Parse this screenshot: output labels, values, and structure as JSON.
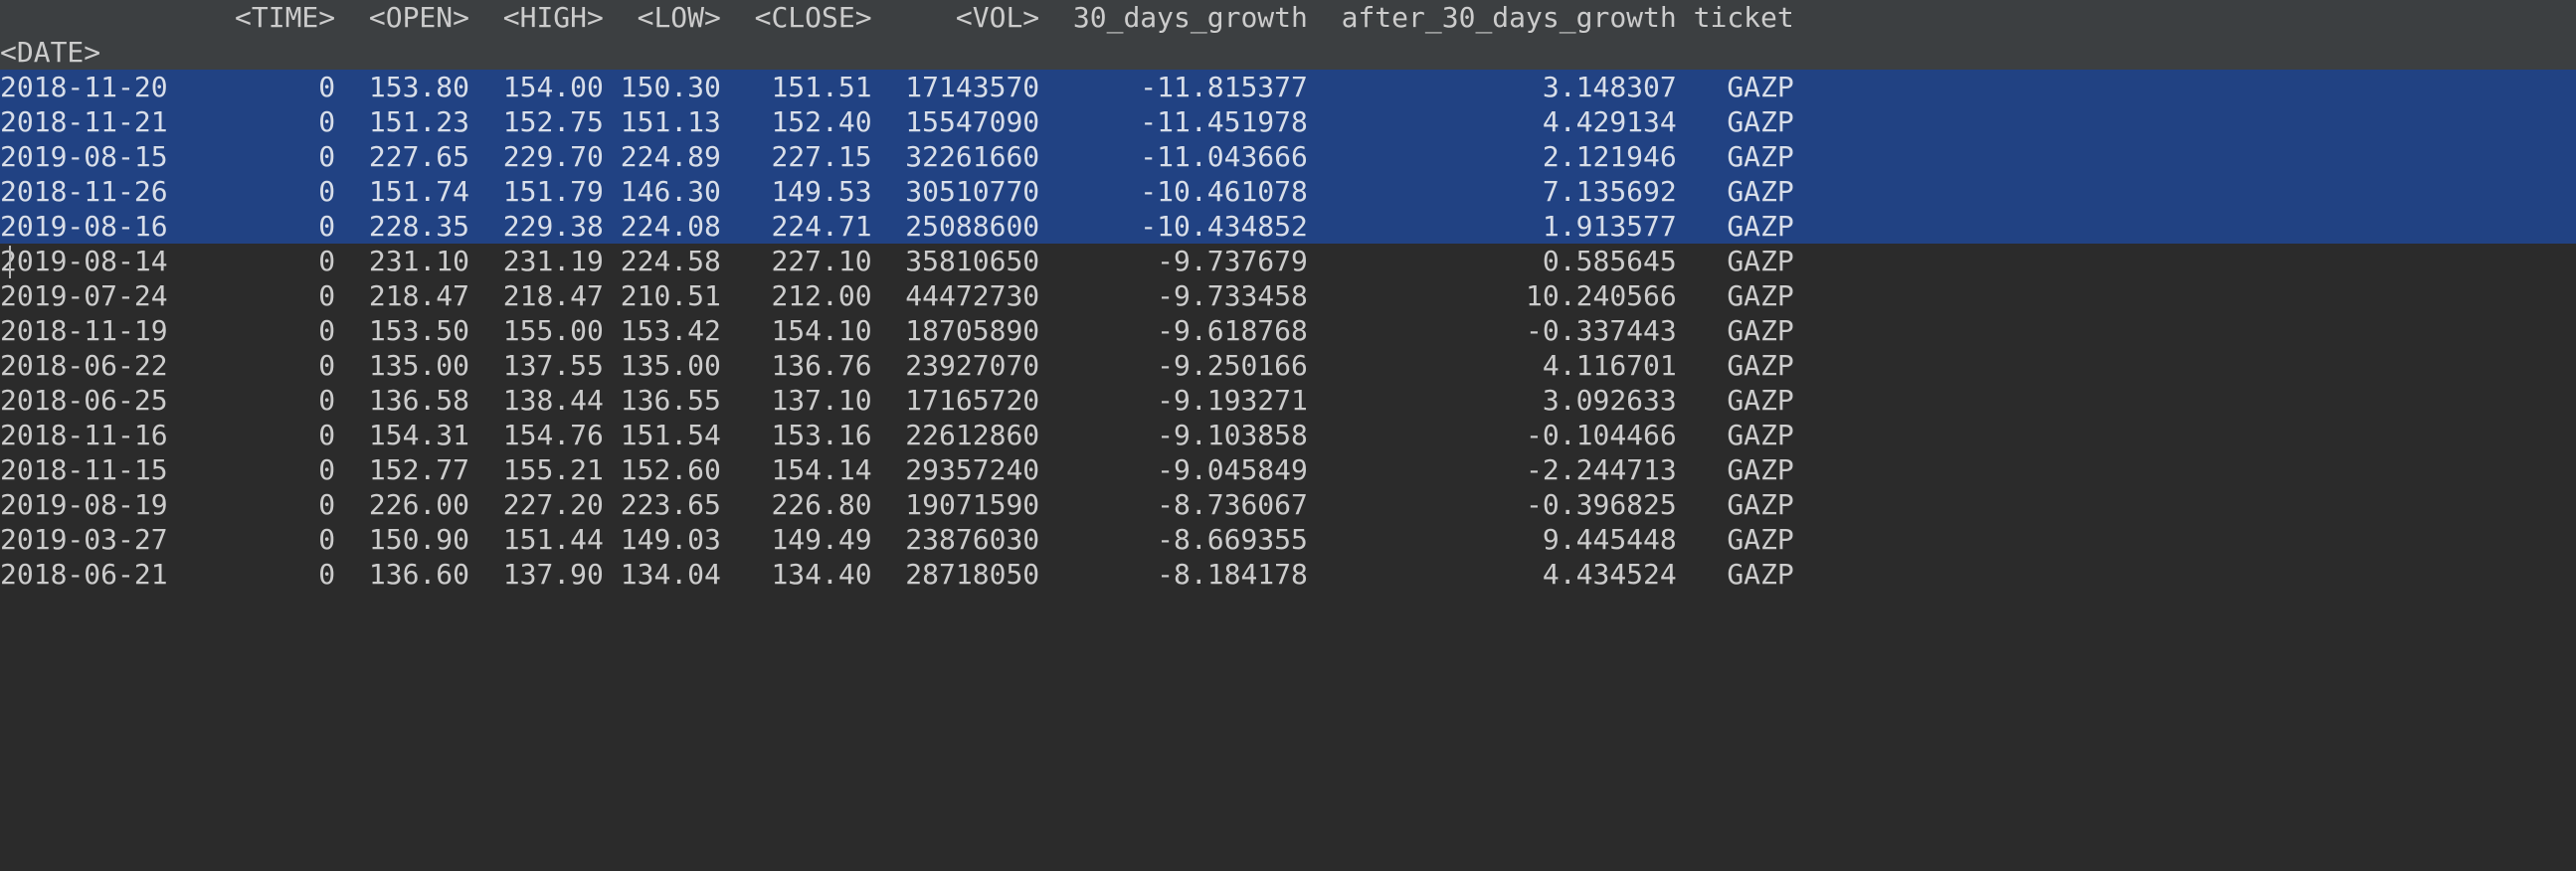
{
  "chart_data": {
    "type": "table",
    "index_name": "<DATE>",
    "columns": [
      "<TIME>",
      "<OPEN>",
      "<HIGH>",
      "<LOW>",
      "<CLOSE>",
      "<VOL>",
      "30_days_growth",
      "after_30_days_growth",
      "ticket"
    ],
    "rows": [
      {
        "DATE": "2018-11-20",
        "TIME": 0,
        "OPEN": 153.8,
        "HIGH": 154.0,
        "LOW": 150.3,
        "CLOSE": 151.51,
        "VOL": 17143570,
        "30_days_growth": -11.815377,
        "after_30_days_growth": 3.148307,
        "ticket": "GAZP",
        "selected": true
      },
      {
        "DATE": "2018-11-21",
        "TIME": 0,
        "OPEN": 151.23,
        "HIGH": 152.75,
        "LOW": 151.13,
        "CLOSE": 152.4,
        "VOL": 15547090,
        "30_days_growth": -11.451978,
        "after_30_days_growth": 4.429134,
        "ticket": "GAZP",
        "selected": true
      },
      {
        "DATE": "2019-08-15",
        "TIME": 0,
        "OPEN": 227.65,
        "HIGH": 229.7,
        "LOW": 224.89,
        "CLOSE": 227.15,
        "VOL": 32261660,
        "30_days_growth": -11.043666,
        "after_30_days_growth": 2.121946,
        "ticket": "GAZP",
        "selected": true
      },
      {
        "DATE": "2018-11-26",
        "TIME": 0,
        "OPEN": 151.74,
        "HIGH": 151.79,
        "LOW": 146.3,
        "CLOSE": 149.53,
        "VOL": 30510770,
        "30_days_growth": -10.461078,
        "after_30_days_growth": 7.135692,
        "ticket": "GAZP",
        "selected": true
      },
      {
        "DATE": "2019-08-16",
        "TIME": 0,
        "OPEN": 228.35,
        "HIGH": 229.38,
        "LOW": 224.08,
        "CLOSE": 224.71,
        "VOL": 25088600,
        "30_days_growth": -10.434852,
        "after_30_days_growth": 1.913577,
        "ticket": "GAZP",
        "selected": true
      },
      {
        "DATE": "2019-08-14",
        "TIME": 0,
        "OPEN": 231.1,
        "HIGH": 231.19,
        "LOW": 224.58,
        "CLOSE": 227.1,
        "VOL": 35810650,
        "30_days_growth": -9.737679,
        "after_30_days_growth": 0.585645,
        "ticket": "GAZP",
        "selected": false
      },
      {
        "DATE": "2019-07-24",
        "TIME": 0,
        "OPEN": 218.47,
        "HIGH": 218.47,
        "LOW": 210.51,
        "CLOSE": 212.0,
        "VOL": 44472730,
        "30_days_growth": -9.733458,
        "after_30_days_growth": 10.240566,
        "ticket": "GAZP",
        "selected": false
      },
      {
        "DATE": "2018-11-19",
        "TIME": 0,
        "OPEN": 153.5,
        "HIGH": 155.0,
        "LOW": 153.42,
        "CLOSE": 154.1,
        "VOL": 18705890,
        "30_days_growth": -9.618768,
        "after_30_days_growth": -0.337443,
        "ticket": "GAZP",
        "selected": false
      },
      {
        "DATE": "2018-06-22",
        "TIME": 0,
        "OPEN": 135.0,
        "HIGH": 137.55,
        "LOW": 135.0,
        "CLOSE": 136.76,
        "VOL": 23927070,
        "30_days_growth": -9.250166,
        "after_30_days_growth": 4.116701,
        "ticket": "GAZP",
        "selected": false
      },
      {
        "DATE": "2018-06-25",
        "TIME": 0,
        "OPEN": 136.58,
        "HIGH": 138.44,
        "LOW": 136.55,
        "CLOSE": 137.1,
        "VOL": 17165720,
        "30_days_growth": -9.193271,
        "after_30_days_growth": 3.092633,
        "ticket": "GAZP",
        "selected": false
      },
      {
        "DATE": "2018-11-16",
        "TIME": 0,
        "OPEN": 154.31,
        "HIGH": 154.76,
        "LOW": 151.54,
        "CLOSE": 153.16,
        "VOL": 22612860,
        "30_days_growth": -9.103858,
        "after_30_days_growth": -0.104466,
        "ticket": "GAZP",
        "selected": false
      },
      {
        "DATE": "2018-11-15",
        "TIME": 0,
        "OPEN": 152.77,
        "HIGH": 155.21,
        "LOW": 152.6,
        "CLOSE": 154.14,
        "VOL": 29357240,
        "30_days_growth": -9.045849,
        "after_30_days_growth": -2.244713,
        "ticket": "GAZP",
        "selected": false
      },
      {
        "DATE": "2019-08-19",
        "TIME": 0,
        "OPEN": 226.0,
        "HIGH": 227.2,
        "LOW": 223.65,
        "CLOSE": 226.8,
        "VOL": 19071590,
        "30_days_growth": -8.736067,
        "after_30_days_growth": -0.396825,
        "ticket": "GAZP",
        "selected": false
      },
      {
        "DATE": "2019-03-27",
        "TIME": 0,
        "OPEN": 150.9,
        "HIGH": 151.44,
        "LOW": 149.03,
        "CLOSE": 149.49,
        "VOL": 23876030,
        "30_days_growth": -8.669355,
        "after_30_days_growth": 9.445448,
        "ticket": "GAZP",
        "selected": false
      },
      {
        "DATE": "2018-06-21",
        "TIME": 0,
        "OPEN": 136.6,
        "HIGH": 137.9,
        "LOW": 134.04,
        "CLOSE": 134.4,
        "VOL": 28718050,
        "30_days_growth": -8.184178,
        "after_30_days_growth": 4.434524,
        "ticket": "GAZP",
        "selected": false
      }
    ]
  },
  "col_widths": {
    "date": 12,
    "time": 8,
    "open": 8,
    "high": 8,
    "low": 7,
    "close": 9,
    "vol": 10,
    "g30": 16,
    "a30": 22,
    "ticket": 7
  },
  "colors": {
    "bg": "#2b2b2b",
    "header_bg": "#3c3f41",
    "select_bg": "#214283",
    "fg": "#cccccc"
  }
}
